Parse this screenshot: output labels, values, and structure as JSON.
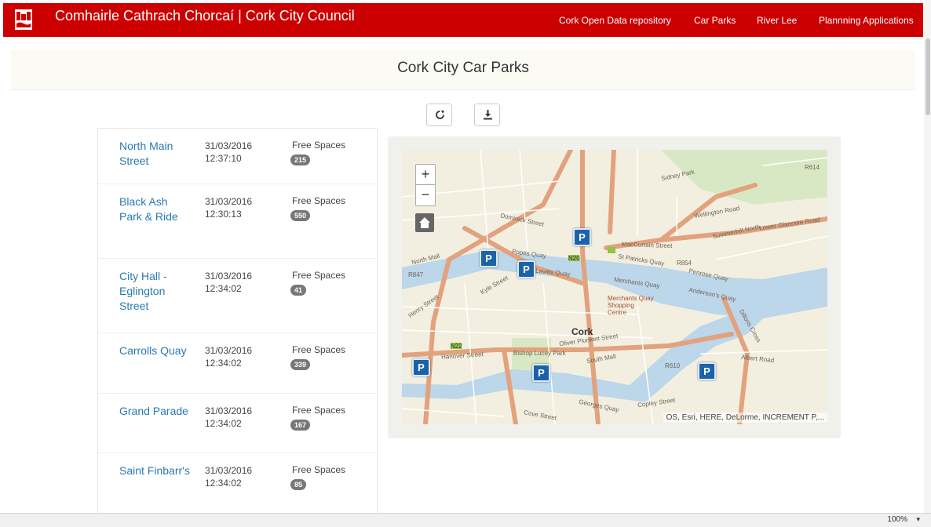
{
  "header": {
    "title": "Comhairle Cathrach Chorcaí | Cork City Council",
    "nav": [
      "Cork Open Data repository",
      "Car Parks",
      "River Lee",
      "Plannning Applications"
    ],
    "bg_color": "#cc0000"
  },
  "page": {
    "title": "Cork City Car Parks"
  },
  "toolbar": {
    "refresh_icon": "refresh-icon",
    "download_icon": "download-icon"
  },
  "carparks": [
    {
      "name": "North Main Street",
      "date": "31/03/2016",
      "time": "12:37:10",
      "free_label": "Free Spaces",
      "free": "215"
    },
    {
      "name": "Black Ash Park & Ride",
      "date": "31/03/2016",
      "time": "12:30:13",
      "free_label": "Free Spaces",
      "free": "550"
    },
    {
      "name": "City Hall - Eglington Street",
      "date": "31/03/2016",
      "time": "12:34:02",
      "free_label": "Free Spaces",
      "free": "41"
    },
    {
      "name": "Carrolls Quay",
      "date": "31/03/2016",
      "time": "12:34:02",
      "free_label": "Free Spaces",
      "free": "339"
    },
    {
      "name": "Grand Parade",
      "date": "31/03/2016",
      "time": "12:34:02",
      "free_label": "Free Spaces",
      "free": "167"
    },
    {
      "name": "Saint Finbarr's",
      "date": "31/03/2016",
      "time": "12:34:02",
      "free_label": "Free Spaces",
      "free": "85"
    }
  ],
  "map": {
    "zoom_in": "+",
    "zoom_out": "−",
    "marker_label": "P",
    "city_label": "Cork",
    "attribution": "OS, Esri, HERE, DeLorme, INCREMENT P,...",
    "labels": [
      "Popes Quay",
      "Lavitts Quay",
      "Merchants Quay",
      "St Patricks Quay",
      "Penrose Quay",
      "MacCurtain Street",
      "Wellington Road",
      "Sidney Park",
      "Anderson's Quay",
      "Oliver Plunkett Street",
      "South Mall",
      "Albert Road",
      "Hanover Street",
      "Georges Quay",
      "Copley Street",
      "Cove Street",
      "Dominick Street",
      "North Mall",
      "Kyle Street",
      "Henry Street",
      "Merchants Quay Shopping Centre",
      "Lower Glanmire Road",
      "Summerhill North",
      "Dillons Cross",
      "Bishop Lucey Park"
    ],
    "road_codes": [
      "N20",
      "R847",
      "R854",
      "N22",
      "R610",
      "R614"
    ],
    "water_color": "#bcd6ea",
    "marker_color": "#1c62a8"
  },
  "status": {
    "zoom": "100%"
  }
}
